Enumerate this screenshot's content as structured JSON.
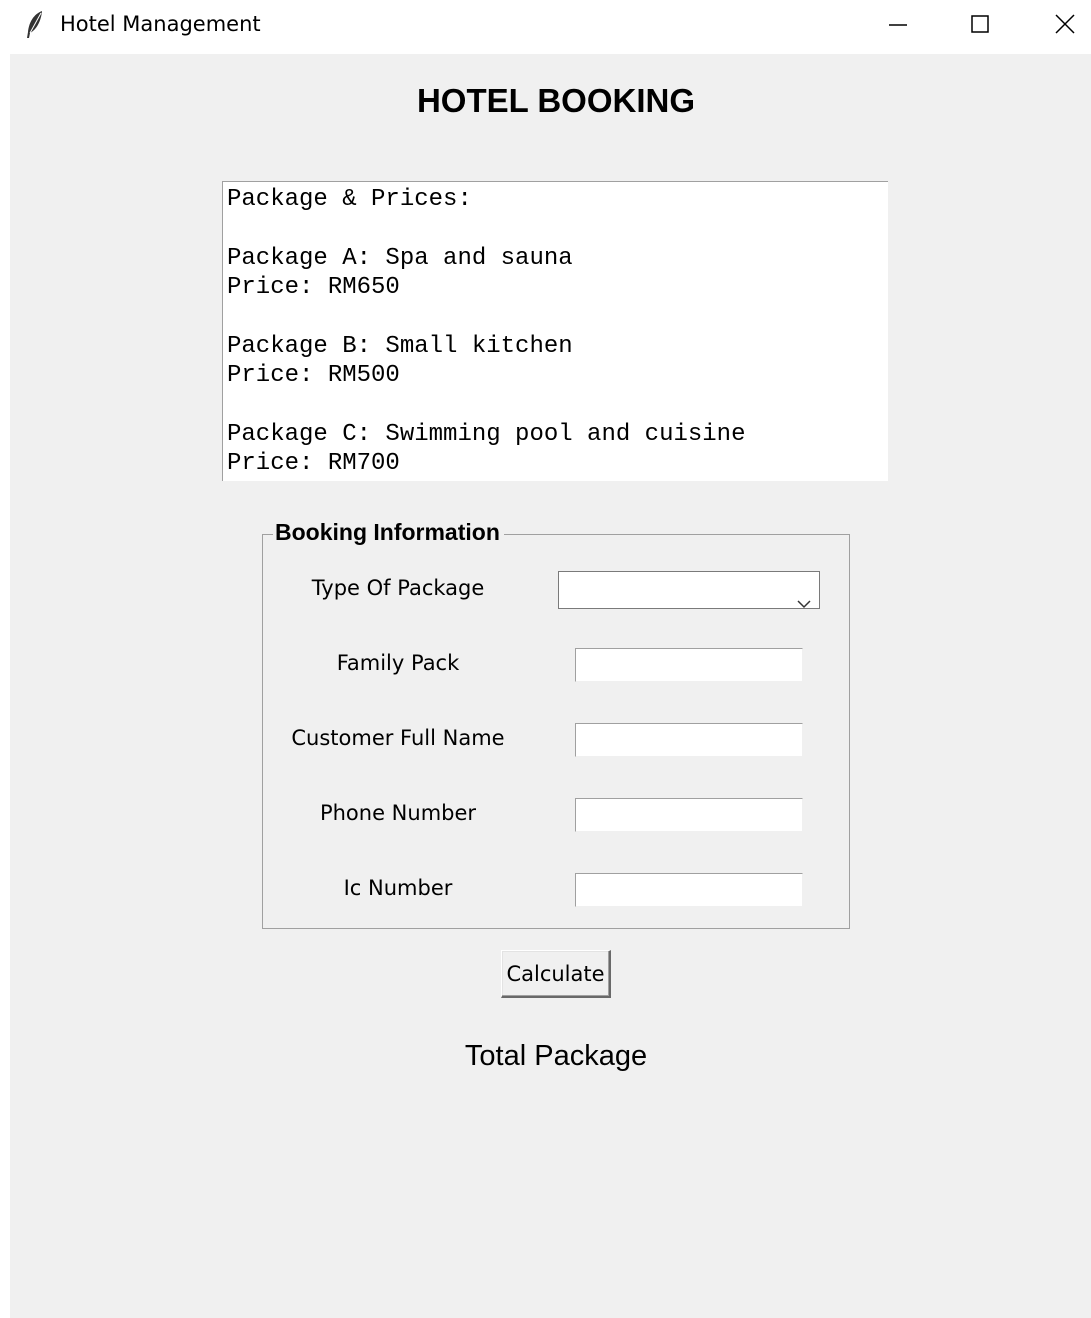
{
  "window": {
    "title": "Hotel Management",
    "icon": "feather-icon",
    "controls": [
      "minimize-icon",
      "maximize-icon",
      "close-icon"
    ]
  },
  "heading": "HOTEL BOOKING",
  "packages_text": {
    "lines": [
      "Package & Prices:",
      "",
      "Package A: Spa and sauna",
      "Price: RM650",
      "",
      "Package B: Small kitchen",
      "Price: RM500",
      "",
      "Package C: Swimming pool and cuisine",
      "Price: RM700"
    ]
  },
  "booking": {
    "title": "Booking Information",
    "type_of_package": {
      "label": "Type Of Package",
      "value": ""
    },
    "family_pack": {
      "label": "Family Pack",
      "value": ""
    },
    "customer_name": {
      "label": "Customer Full Name",
      "value": ""
    },
    "phone_number": {
      "label": "Phone Number",
      "value": ""
    },
    "ic_number": {
      "label": "Ic Number",
      "value": ""
    }
  },
  "calculate_label": "Calculate",
  "total_label": "Total Package"
}
